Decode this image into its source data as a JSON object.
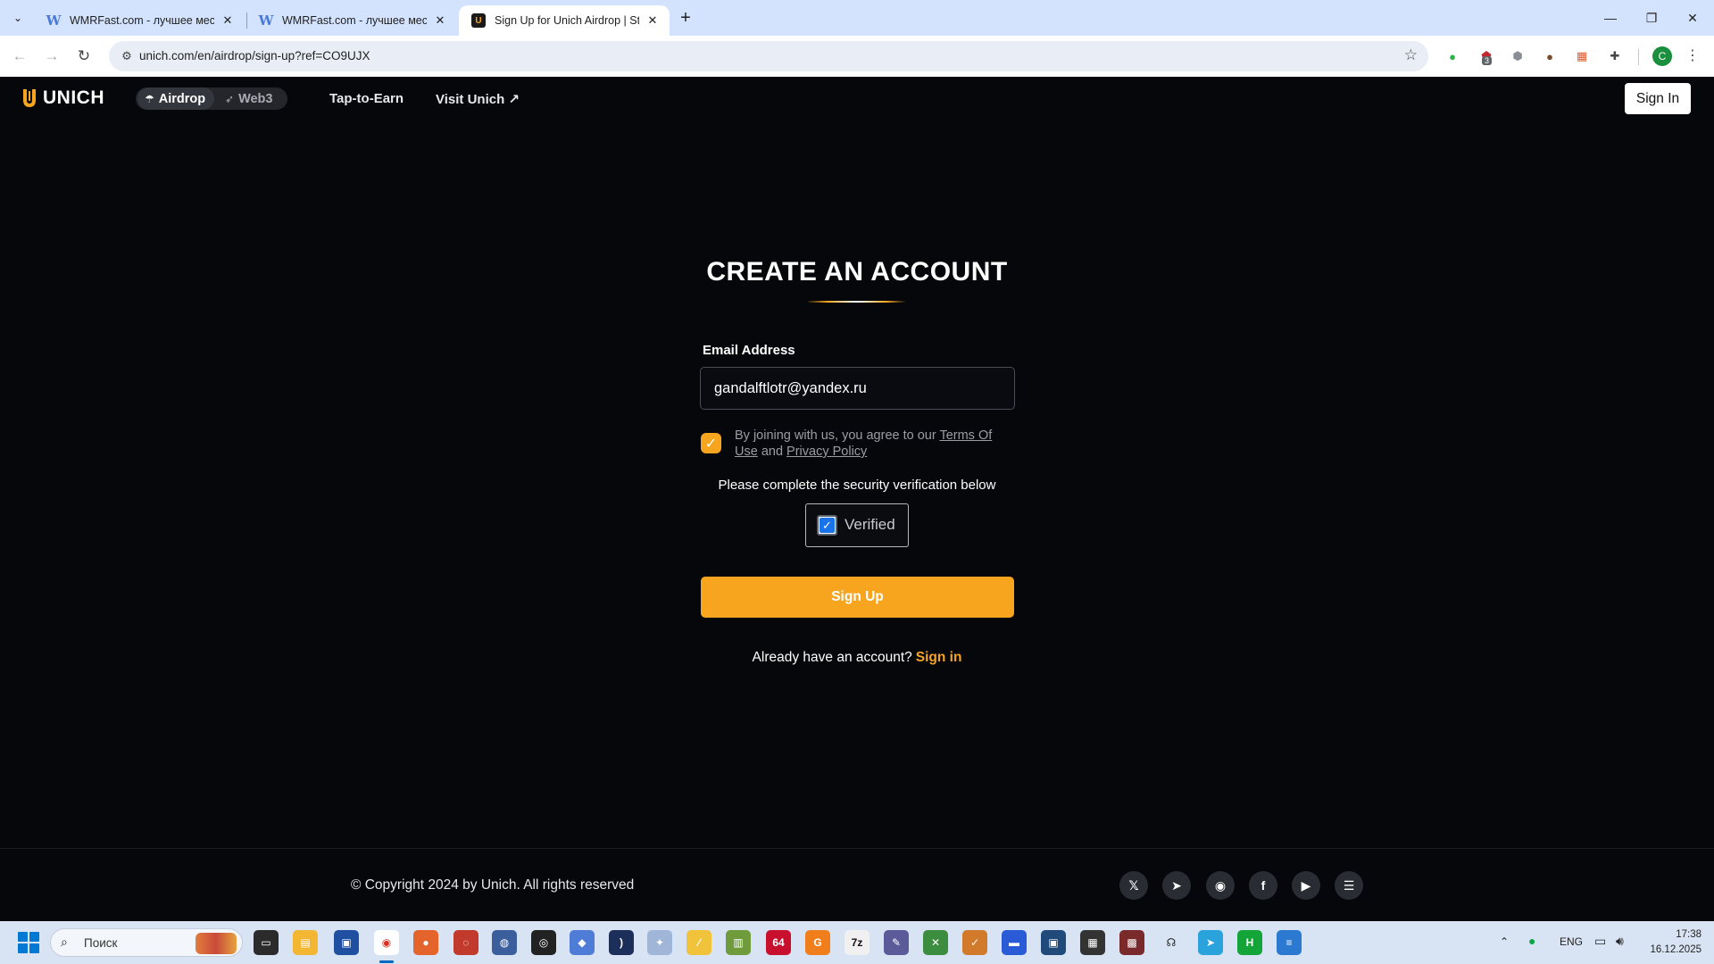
{
  "browser": {
    "tabs": [
      {
        "title": "WMRFast.com - лучшее место",
        "favicon": "w-letter-icon",
        "active": false
      },
      {
        "title": "WMRFast.com - лучшее место",
        "favicon": "w-letter-icon",
        "active": false
      },
      {
        "title": "Sign Up for Unich Airdrop | Sta",
        "favicon": "unich-logo-icon",
        "active": true
      }
    ],
    "url": "unich.com/en/airdrop/sign-up?ref=CO9UJX",
    "extension_badge": "3",
    "profile_initial": "C"
  },
  "header": {
    "logo_text": "UNICH",
    "segment": [
      {
        "label": "Airdrop",
        "icon": "parachute-icon",
        "active": true
      },
      {
        "label": "Web3",
        "icon": "rocket-icon",
        "active": false
      }
    ],
    "nav": [
      {
        "label": "Tap-to-Earn"
      },
      {
        "label": "Visit Unich ↗"
      }
    ],
    "sign_in_label": "Sign In"
  },
  "form": {
    "title": "CREATE AN ACCOUNT",
    "email_label": "Email Address",
    "email_value": "gandalftlotr@yandex.ru",
    "agree_checked": true,
    "agree_prefix": "By joining with us, you agree to our ",
    "terms_label": "Terms Of Use",
    "agree_and": " and ",
    "privacy_label": "Privacy Policy",
    "verify_note": "Please complete the security verification below",
    "verify_label": "Verified",
    "verify_checked": true,
    "submit_label": "Sign Up",
    "have_account_text": "Already have an account?",
    "sign_in_link": "Sign in"
  },
  "footer": {
    "copyright": "© Copyright 2024 by Unich. All rights reserved",
    "social": [
      "x-icon",
      "telegram-icon",
      "discord-icon",
      "facebook-icon",
      "youtube-icon",
      "gitbook-icon"
    ]
  },
  "taskbar": {
    "search_placeholder": "Поиск",
    "language": "ENG",
    "time": "17:38",
    "date": "16.12.2025"
  },
  "colors": {
    "accent": "#f7a51e",
    "background": "#06070b",
    "input_border": "#4b4d55"
  }
}
